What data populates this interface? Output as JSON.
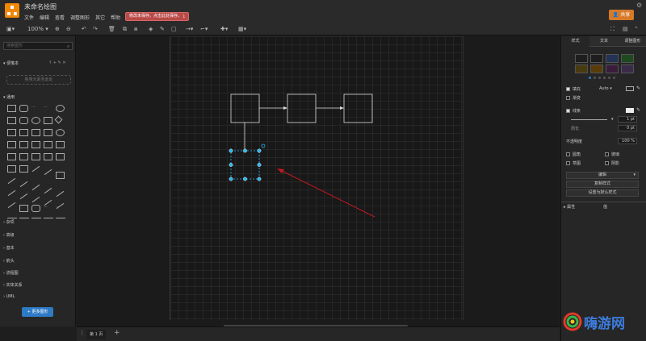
{
  "app": {
    "title": "未命名绘图"
  },
  "menu": [
    "文件",
    "编辑",
    "查看",
    "调整图形",
    "其它",
    "帮助"
  ],
  "save_warning": "修改未保存。点击此处保存。",
  "share_label": "共享",
  "toolbar": {
    "zoom": "100%"
  },
  "left_panel": {
    "search_placeholder": "搜索图形",
    "scratchpad_title": "便笺本",
    "scratchpad_hint": "拖曳元素至此处",
    "general_title": "通用",
    "sections": [
      "杂项",
      "高级",
      "基本",
      "箭头",
      "流程图",
      "实体关系",
      "UML"
    ],
    "more_shapes": "+ 更多图形"
  },
  "right_panel": {
    "tabs": [
      "样式",
      "文本",
      "调整图形"
    ],
    "fill_label": "填充",
    "fill_mode": "Auto",
    "gradient_label": "渐变",
    "line_label": "线条",
    "line_width": "1 pt",
    "perimeter_label": "周长",
    "perimeter_value": "0 pt",
    "opacity_label": "不透明度",
    "opacity_value": "100 %",
    "rounded_label": "圆角",
    "glass_label": "玻璃",
    "sketch_label": "草图",
    "shadow_label": "阴影",
    "edit_label": "编辑",
    "copy_style": "复制样式",
    "set_default_style": "设置为默认样式",
    "props_label": "属性",
    "value_label": "值",
    "swatch_colors": [
      "#1e1e1e",
      "#1e1e1e",
      "#223355",
      "#1f4a1f",
      "#4a3a10",
      "#5a3c0a",
      "#3a1d3a",
      "#3a2a4a"
    ]
  },
  "bottom": {
    "page_tab": "第 1 页"
  },
  "watermark": {
    "text": "嗨游网"
  },
  "colors": {
    "accent": "#d77a28",
    "selection": "#29b6f2",
    "arrow": "#c0191e"
  }
}
